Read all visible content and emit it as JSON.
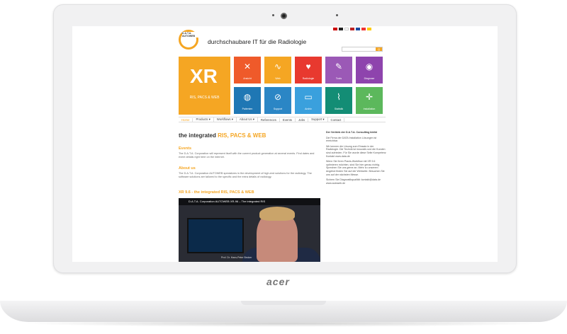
{
  "laptop": {
    "brand": "acer"
  },
  "site": {
    "logo_text": "D.A.T.A. AUTOWEB",
    "tagline": "durchschaubare IT für die Radiologie",
    "search": {
      "placeholder": "",
      "button": "Q"
    },
    "hero": {
      "big": "XR",
      "sub": "RIS, PACS & WEB"
    },
    "tiles": [
      {
        "label": "Ansicht",
        "color": "#ef5a2a",
        "icon": "✕"
      },
      {
        "label": "Web",
        "color": "#f5a623",
        "icon": "∿"
      },
      {
        "label": "Radiologie",
        "color": "#e8392f",
        "icon": "♥"
      },
      {
        "label": "Tools",
        "color": "#9b59b6",
        "icon": "✎"
      },
      {
        "label": "Diagnose",
        "color": "#8e44ad",
        "icon": "◉"
      },
      {
        "label": "Patienten",
        "color": "#1f77b4",
        "icon": "◍"
      },
      {
        "label": "Support",
        "color": "#2b86c5",
        "icon": "⊘"
      },
      {
        "label": "Archiv",
        "color": "#3aa0dd",
        "icon": "▭"
      },
      {
        "label": "Statistik",
        "color": "#138d75",
        "icon": "⌇"
      },
      {
        "label": "Installation",
        "color": "#5cb85c",
        "icon": "✛"
      }
    ],
    "nav": [
      "Home",
      "Products ▾",
      "Workflows ▾",
      "About Us ▾",
      "References",
      "Events",
      "Jobs",
      "Support ▾",
      "Contact"
    ],
    "heading": {
      "pre": "the integrated ",
      "accent": "RIS, PACS & WEB"
    },
    "events": {
      "title": "Events",
      "text": "The D.A.T.A. Corporation will represent itself with the current product generation at several events. Find dates and event details right here on the internet."
    },
    "about": {
      "title": "About us",
      "text": "The D.A.T.A. Corporation AUTOWEB specializes in the development of high-end solutions for the radiology. The software solutions are tailored to the specific and the extra details of radiology."
    },
    "xr": {
      "title": "XR 9.6 - the integrated RIS, PACS & WEB"
    },
    "video": {
      "title": "D.A.T.A. Corporation AUTOWEB XR-96 – The integrated RIS",
      "caption": "Prof. Dr. Hans-Peter Becker"
    },
    "sidebar": [
      {
        "bold": "Der Vertrieb der D.A.T.A. Consulting bleibt",
        "text": ""
      },
      {
        "bold": "",
        "text": "Die Firma der DATA Installation Lösungen ist erreichbar."
      },
      {
        "bold": "",
        "text": "Wir kennen die Lösung zum Einsatz in der Radiologie. Die Technik ist innovativ und die Kunden sind zufrieden. Für Sie wurde diese Seite Kompetenz Kontakt www.data.de"
      },
      {
        "bold": "",
        "text": "Wenn Sie Ihren Praxis-Workflow mit XR 9.6 optimieren möchten, sind Sie hier genau richtig. Sprechen Sie uns gerne an. Mehr zu unserem Angebot finden Sie auf der Webseite. Besuchen Sie uns auf der nächsten Messe."
      },
      {
        "bold": "",
        "text": "Sichern Sie Diagnostikqualität: kontakt@data.de www.autoweb.de"
      }
    ]
  }
}
